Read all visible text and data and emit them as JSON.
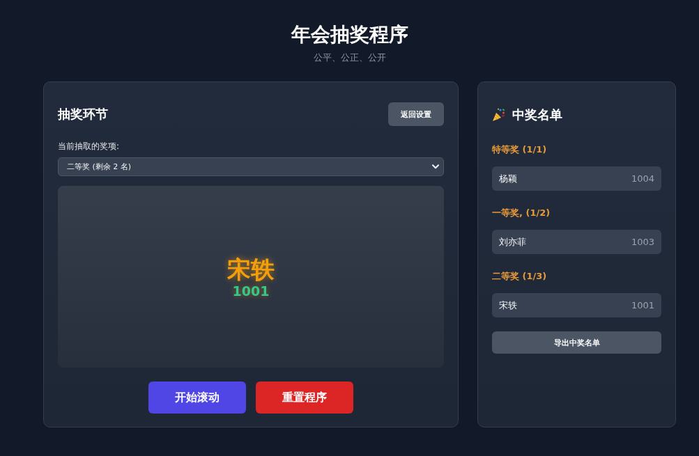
{
  "header": {
    "title": "年会抽奖程序",
    "subtitle": "公平、公正、公开"
  },
  "draw_panel": {
    "title": "抽奖环节",
    "back_button": "返回设置",
    "prize_label": "当前抽取的奖项:",
    "prize_select": {
      "value": "二等奖 (剩余 2 名)"
    },
    "display": {
      "name": "宋轶",
      "number": "1001"
    },
    "buttons": [
      {
        "label": "开始滚动",
        "kind": "primary"
      },
      {
        "label": "重置程序",
        "kind": "danger"
      }
    ]
  },
  "winners_panel": {
    "title": "中奖名单",
    "groups": [
      {
        "heading": "特等奖 (1/1)",
        "winners": [
          {
            "name": "杨颖",
            "number": "1004"
          }
        ]
      },
      {
        "heading": "一等奖, (1/2)",
        "winners": [
          {
            "name": "刘亦菲",
            "number": "1003"
          }
        ]
      },
      {
        "heading": "二等奖 (1/3)",
        "winners": [
          {
            "name": "宋轶",
            "number": "1001"
          }
        ]
      }
    ],
    "export_button": "导出中奖名单"
  }
}
